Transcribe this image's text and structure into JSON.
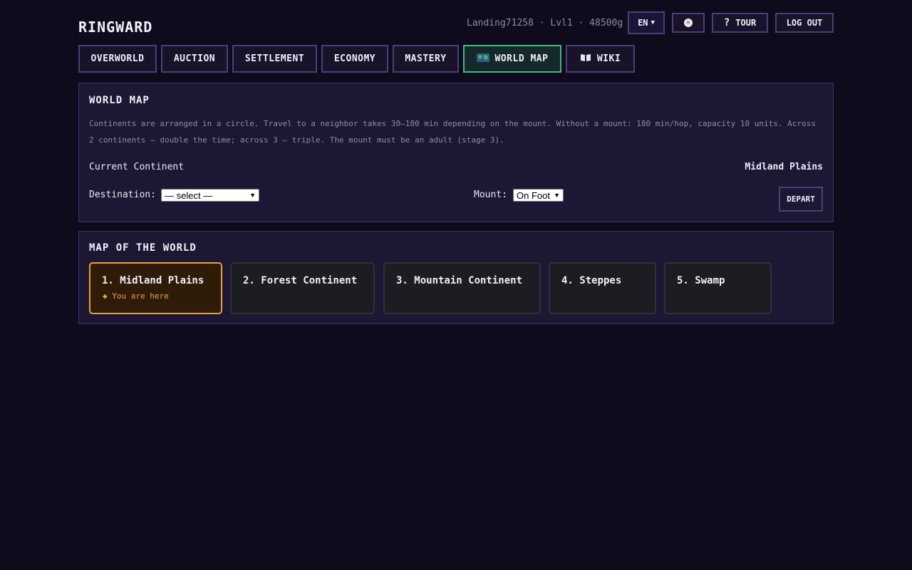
{
  "header": {
    "brand": "RINGWARD",
    "user_info": "Landing71258 · Lvl1 · 48500g",
    "language": "EN",
    "tour_label": "TOUR",
    "logout_label": "LOG OUT"
  },
  "tabs": [
    {
      "label": "OVERWORLD",
      "icon": null,
      "active": false
    },
    {
      "label": "AUCTION",
      "icon": null,
      "active": false
    },
    {
      "label": "SETTLEMENT",
      "icon": null,
      "active": false
    },
    {
      "label": "ECONOMY",
      "icon": null,
      "active": false
    },
    {
      "label": "MASTERY",
      "icon": null,
      "active": false
    },
    {
      "label": "WORLD MAP",
      "icon": "world-map-icon",
      "active": true
    },
    {
      "label": "WIKI",
      "icon": "book-icon",
      "active": false
    }
  ],
  "world_map": {
    "title": "WORLD MAP",
    "description": "Continents are arranged in a circle. Travel to a neighbor takes 30–180 min depending on the mount. Without a mount: 180 min/hop, capacity 10 units. Across 2 continents — double the time; across 3 — triple. The mount must be an adult (stage 3).",
    "current_label": "Current Continent",
    "current_value": "Midland Plains",
    "destination_label": "Destination:",
    "destination_value": "— select —",
    "mount_label": "Mount:",
    "mount_value": "On Foot",
    "depart_label": "DEPART"
  },
  "map_section": {
    "title": "MAP OF THE WORLD",
    "continents": [
      {
        "name": "1. Midland Plains",
        "current": true,
        "marker": "◆ You are here"
      },
      {
        "name": "2. Forest Continent",
        "current": false
      },
      {
        "name": "3. Mountain Continent",
        "current": false
      },
      {
        "name": "4. Steppes",
        "current": false
      },
      {
        "name": "5. Swamp",
        "current": false
      }
    ]
  },
  "colors": {
    "background": "#0f0b1d",
    "panel": "#1e1733",
    "border": "#4a3f78",
    "active_tab": "#3fb884",
    "current_card": "#e8a13a"
  }
}
